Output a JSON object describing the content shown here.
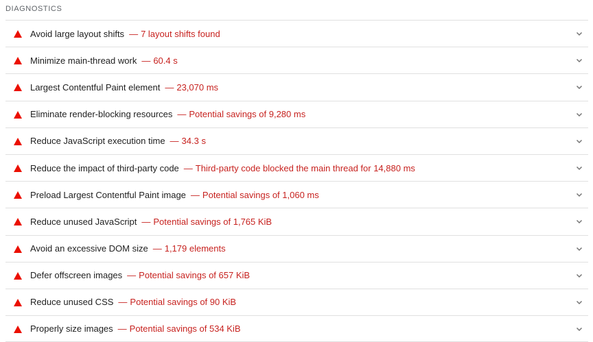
{
  "section": {
    "title": "DIAGNOSTICS"
  },
  "colors": {
    "fail_red": "#eb0f00",
    "value_red": "#c7221f",
    "divider": "#e0e0e0"
  },
  "separator": "—",
  "audits": [
    {
      "title": "Avoid large layout shifts",
      "value": "7 layout shifts found",
      "icon": "fail-triangle-icon"
    },
    {
      "title": "Minimize main-thread work",
      "value": "60.4 s",
      "icon": "fail-triangle-icon"
    },
    {
      "title": "Largest Contentful Paint element",
      "value": "23,070 ms",
      "icon": "fail-triangle-icon"
    },
    {
      "title": "Eliminate render-blocking resources",
      "value": "Potential savings of 9,280 ms",
      "icon": "fail-triangle-icon"
    },
    {
      "title": "Reduce JavaScript execution time",
      "value": "34.3 s",
      "icon": "fail-triangle-icon"
    },
    {
      "title": "Reduce the impact of third-party code",
      "value": "Third-party code blocked the main thread for 14,880 ms",
      "icon": "fail-triangle-icon"
    },
    {
      "title": "Preload Largest Contentful Paint image",
      "value": "Potential savings of 1,060 ms",
      "icon": "fail-triangle-icon"
    },
    {
      "title": "Reduce unused JavaScript",
      "value": "Potential savings of 1,765 KiB",
      "icon": "fail-triangle-icon"
    },
    {
      "title": "Avoid an excessive DOM size",
      "value": "1,179 elements",
      "icon": "fail-triangle-icon"
    },
    {
      "title": "Defer offscreen images",
      "value": "Potential savings of 657 KiB",
      "icon": "fail-triangle-icon"
    },
    {
      "title": "Reduce unused CSS",
      "value": "Potential savings of 90 KiB",
      "icon": "fail-triangle-icon"
    },
    {
      "title": "Properly size images",
      "value": "Potential savings of 534 KiB",
      "icon": "fail-triangle-icon"
    }
  ]
}
